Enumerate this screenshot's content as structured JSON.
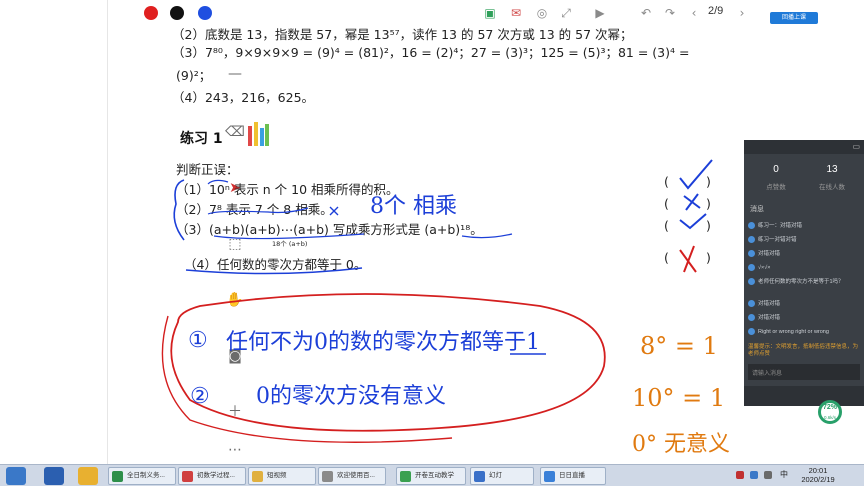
{
  "toolbar": {
    "colors": [
      "#e02020",
      "#111111",
      "#1f4fe0"
    ],
    "page_indicator": "2/9"
  },
  "live_badge": "回播上课",
  "content": {
    "line1": "（2）底数是 13，指数是 57，幂是 13⁵⁷，读作 13 的 57 次方或 13 的 57 次幂；",
    "line2": "（3）7⁸⁰，9×9×9×9 = (9)⁴ = (81)²，16 = (2)⁴；27 = (3)³；125 = (5)³；81 = (3)⁴ =",
    "line3": "(9)²；",
    "line4": "（4）243，216，625。",
    "exercise_title": "练习 1",
    "judge_label": "判断正误：",
    "q1": "（1）10ⁿ 表示 n 个 10 相乘所得的积。",
    "q2": "（2）7⁸ 表示 7 个 8 相乘。",
    "q3": "（3）(a+b)(a+b)⋯(a+b) 写成乘方形式是 (a+b)¹⁸。",
    "q3_sub": "18个 (a+b)",
    "q4": "（4）任何数的零次方都等于 0。",
    "brackets": [
      "(",
      ")",
      "(",
      ")",
      "(",
      ")",
      "(",
      ")"
    ]
  },
  "handwriting": {
    "note_q2": "8个 相乘",
    "circle1_num": "①",
    "circle1_text": "任何不为0的数的零次方都等于1",
    "circle2_num": "②",
    "circle2_text": "0的零次方没有意义",
    "eq1": "8° = 1",
    "eq2": "10° = 1",
    "eq3": "0° 无意义"
  },
  "panel": {
    "header": "",
    "stat_left_num": "0",
    "stat_left_label": "点赞数",
    "stat_right_num": "13",
    "stat_right_label": "在线人数",
    "messages_tab": "消息",
    "messages": [
      {
        "text": "练习一：对错对错"
      },
      {
        "text": "练习一对错对错"
      },
      {
        "text": "对错对错"
      },
      {
        "text": "√×√×"
      },
      {
        "text": "老师任何数的零次方不是等于1吗？"
      },
      {
        "text": "对错对错"
      },
      {
        "text": "对错对错"
      },
      {
        "text": "Right or wrong right or wrong"
      },
      {
        "text": "温馨提示：文明发言，抵制低俗违禁信息，为老师点赞",
        "warn": true
      }
    ],
    "input_placeholder": "请输入消息",
    "progress": "72%",
    "progress_sub": "0.6k/s"
  },
  "taskbar": {
    "tasks": [
      "全日制义务...",
      "初数学过程...",
      "短视频",
      "欢迎使用百...",
      "开卷互动教学",
      "幻灯",
      "日日直播"
    ],
    "time": "20:01",
    "date": "2020/2/19",
    "ime": "中"
  }
}
